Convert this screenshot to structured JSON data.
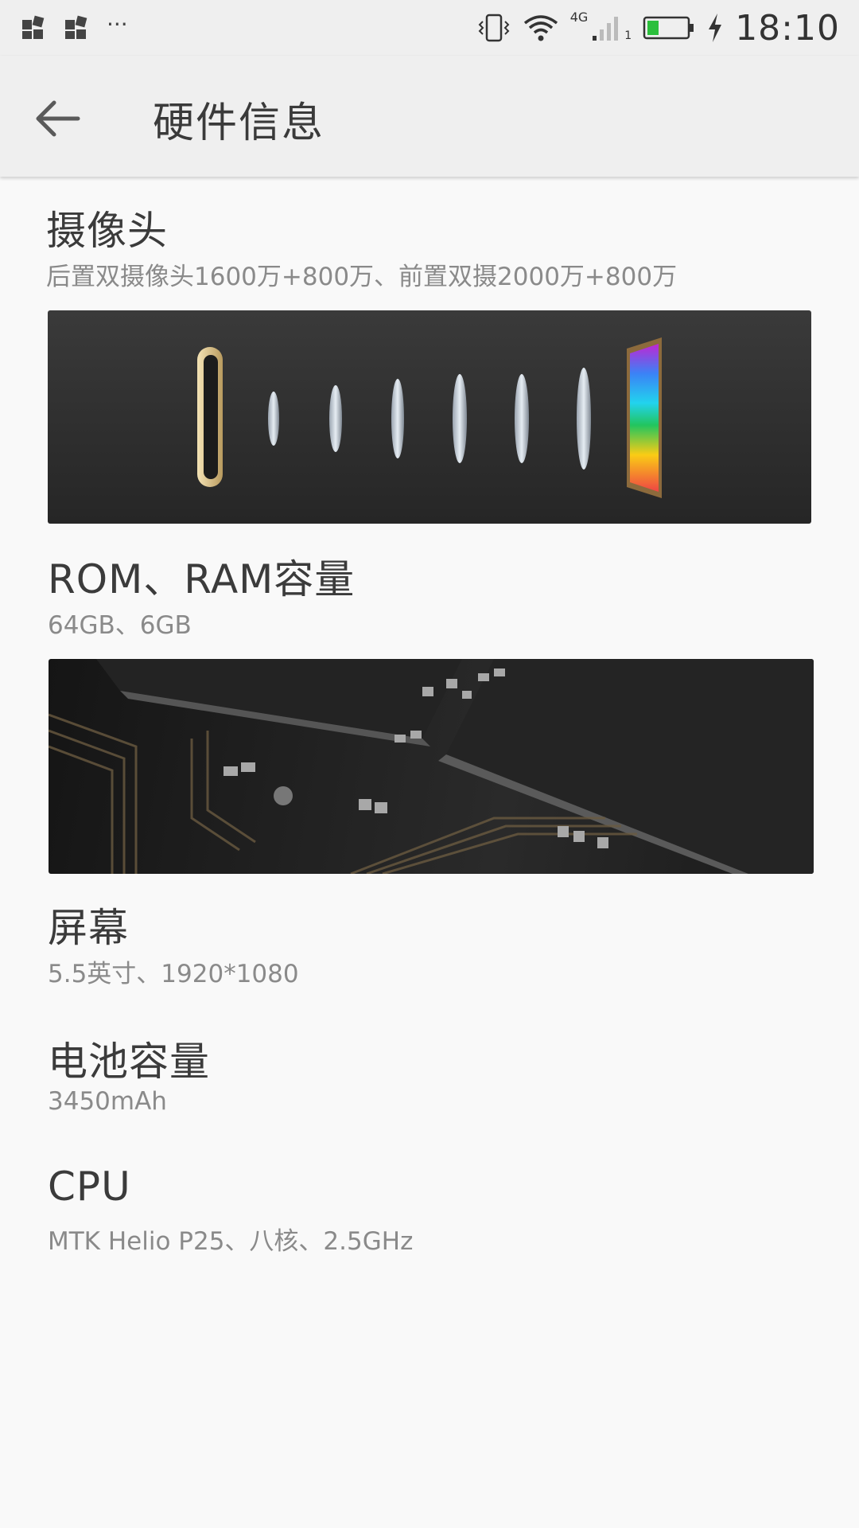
{
  "status_bar": {
    "time": "18:10",
    "network_type": "4G",
    "sim_slot": "1",
    "notification_icons": [
      "app-notification-icon",
      "app-notification-icon",
      "more-notifications-icon"
    ],
    "more_label": "···",
    "battery_color": "#2bbf3c"
  },
  "app_bar": {
    "title": "硬件信息",
    "back_icon": "arrow-left-icon"
  },
  "sections": [
    {
      "title": "摄像头",
      "detail": "后置双摄像头1600万+800万、前置双摄2000万+800万",
      "image": "camera-lens-exploded-view"
    },
    {
      "title": "ROM、RAM容量",
      "detail": "64GB、6GB",
      "image": "circuit-board-chips"
    },
    {
      "title": "屏幕",
      "detail": "5.5英寸、1920*1080"
    },
    {
      "title": "电池容量",
      "detail": "3450mAh"
    },
    {
      "title": "CPU",
      "detail": "MTK Helio P25、八核、2.5GHz"
    }
  ],
  "colors": {
    "background": "#f9f9f9",
    "bar_background": "#efefef",
    "title_text": "#3b3b3b",
    "detail_text": "#8a8a8a",
    "banner_dark": "#2c2c2c"
  }
}
